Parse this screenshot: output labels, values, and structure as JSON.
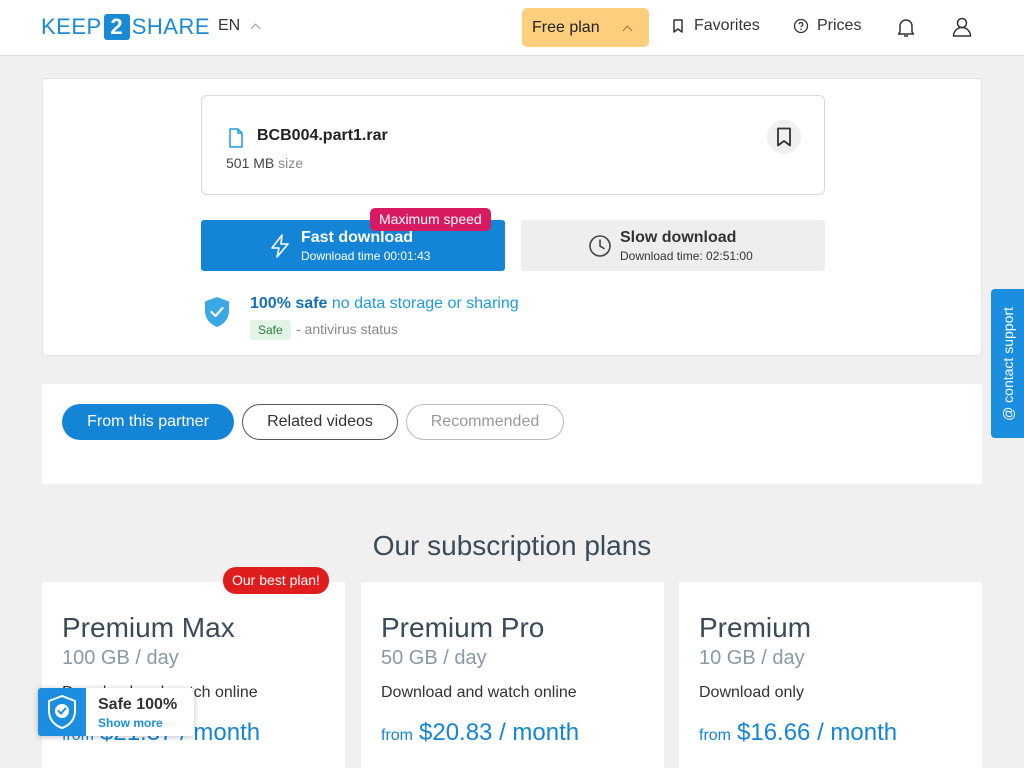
{
  "header": {
    "logo": {
      "pre": "KEEP",
      "num": "2",
      "post": "SHARE"
    },
    "language": "EN",
    "plan_button": "Free plan",
    "favorites": "Favorites",
    "prices": "Prices"
  },
  "file": {
    "name": "BCB004.part1.rar",
    "size": "501 MB",
    "size_label": "size"
  },
  "download": {
    "fast_title": "Fast download",
    "fast_time": "Download time 00:01:43",
    "max_speed_badge": "Maximum speed",
    "slow_title": "Slow download",
    "slow_time": "Download time: 02:51:00"
  },
  "safety": {
    "strong": "100% safe",
    "rest": "no data storage or sharing",
    "badge": "Safe",
    "status": "- antivirus status"
  },
  "tabs": [
    {
      "label": "From this partner",
      "state": "active"
    },
    {
      "label": "Related videos",
      "state": "normal"
    },
    {
      "label": "Recommended",
      "state": "disabled"
    }
  ],
  "plans": {
    "title": "Our subscription plans",
    "best_badge": "Our best plan!",
    "items": [
      {
        "name": "Premium Max",
        "quota": "100 GB / day",
        "desc": "Download and watch online",
        "from": "from",
        "price": "$21.37 / month"
      },
      {
        "name": "Premium Pro",
        "quota": "50 GB / day",
        "desc": "Download and watch online",
        "from": "from",
        "price": "$20.83 / month"
      },
      {
        "name": "Premium",
        "quota": "10 GB / day",
        "desc": "Download only",
        "from": "from",
        "price": "$16.66 / month"
      }
    ]
  },
  "support_tab": "@ contact support",
  "safe_widget": {
    "title": "Safe 100%",
    "link": "Show more"
  },
  "colors": {
    "brand": "#1485d6",
    "plan_button": "#fbcf7e",
    "max_speed": "#d81b60",
    "best_plan": "#e01d1d"
  }
}
